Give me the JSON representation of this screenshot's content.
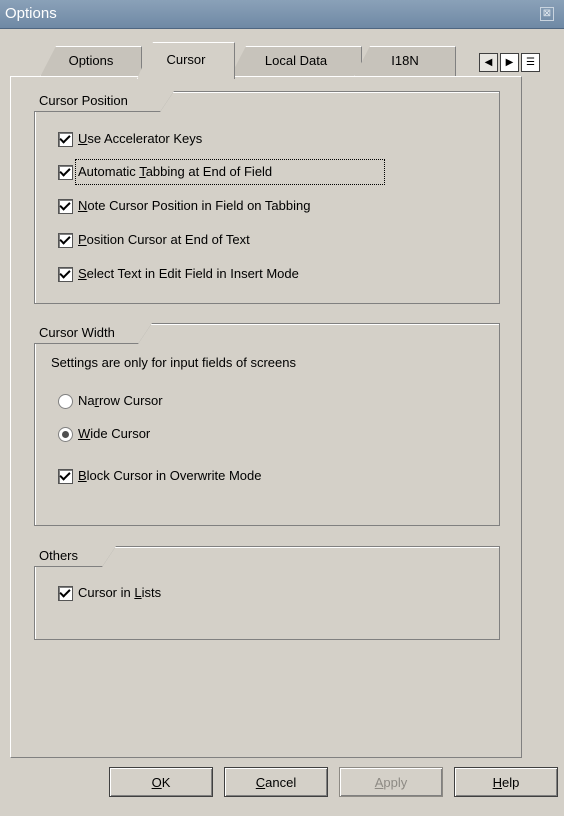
{
  "window": {
    "title": "Options",
    "close_glyph": "⊠"
  },
  "tabs": [
    {
      "label": "Options",
      "active": false
    },
    {
      "label": "Cursor",
      "active": true
    },
    {
      "label": "Local Data",
      "active": false
    },
    {
      "label": "I18N",
      "active": false
    }
  ],
  "tab_nav": {
    "prev_glyph": "◀",
    "next_glyph": "▶",
    "list_glyph": "☰"
  },
  "cursor_position": {
    "label": "Cursor Position",
    "items": [
      {
        "label_pre": "",
        "label_ul": "U",
        "label_post": "se Accelerator Keys",
        "checked": true
      },
      {
        "label_pre": "Automatic ",
        "label_ul": "T",
        "label_post": "abbing at End of Field",
        "checked": true,
        "focused": true
      },
      {
        "label_pre": "",
        "label_ul": "N",
        "label_post": "ote Cursor Position in Field on Tabbing",
        "checked": true
      },
      {
        "label_pre": "",
        "label_ul": "P",
        "label_post": "osition Cursor at End of Text",
        "checked": true
      },
      {
        "label_pre": "",
        "label_ul": "S",
        "label_post": "elect Text in Edit Field in Insert Mode",
        "checked": true
      }
    ]
  },
  "cursor_width": {
    "label": "Cursor Width",
    "note": "Settings are only for input fields of screens",
    "narrow": {
      "label_pre": "Na",
      "label_ul": "r",
      "label_post": "row Cursor",
      "selected": false
    },
    "wide": {
      "label_pre": "",
      "label_ul": "W",
      "label_post": "ide Cursor",
      "selected": true
    },
    "block": {
      "label_pre": "",
      "label_ul": "B",
      "label_post": "lock Cursor in Overwrite Mode",
      "checked": true
    }
  },
  "others": {
    "label": "Others",
    "lists": {
      "label_pre": "Cursor in ",
      "label_ul": "L",
      "label_post": "ists",
      "checked": true
    }
  },
  "buttons": {
    "ok": {
      "ul": "O",
      "rest": "K"
    },
    "cancel": {
      "ul": "C",
      "rest": "ancel"
    },
    "apply": {
      "ul": "A",
      "rest": "pply"
    },
    "help": {
      "ul": "H",
      "rest": "elp"
    }
  }
}
